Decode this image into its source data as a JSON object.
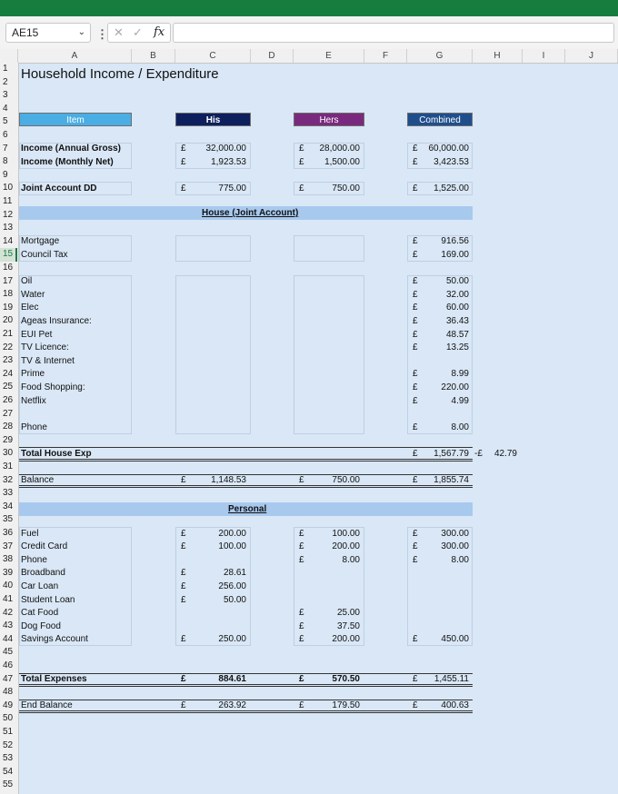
{
  "namebox": {
    "value": "AE15",
    "chevron": "⌄"
  },
  "formula": {
    "separator": "⋮",
    "cancel": "✕",
    "enter": "✓",
    "fx": "fx",
    "value": ""
  },
  "columns": [
    "A",
    "B",
    "C",
    "D",
    "E",
    "F",
    "G",
    "H",
    "I",
    "J"
  ],
  "title": "Household Income / Expenditure",
  "headers": {
    "item": "Item",
    "his": "His",
    "hers": "Hers",
    "combined": "Combined"
  },
  "income": [
    {
      "label": "Income (Annual Gross)",
      "his": "32,000.00",
      "hers": "28,000.00",
      "combined": "60,000.00"
    },
    {
      "label": "Income (Monthly Net)",
      "his": "1,923.53",
      "hers": "1,500.00",
      "combined": "3,423.53"
    }
  ],
  "joint_dd": {
    "label": "Joint Account DD",
    "his": "775.00",
    "hers": "750.00",
    "combined": "1,525.00"
  },
  "house_heading": "House (Joint Account)",
  "house_items": [
    {
      "row": 14,
      "label": "Mortgage",
      "combined": "916.56"
    },
    {
      "row": 15,
      "label": "Council Tax",
      "combined": "169.00"
    },
    {
      "row": 17,
      "label": "Oil",
      "combined": "50.00"
    },
    {
      "row": 18,
      "label": "Water",
      "combined": "32.00"
    },
    {
      "row": 19,
      "label": "Elec",
      "combined": "60.00"
    },
    {
      "row": 20,
      "label": "Ageas Insurance:",
      "combined": "36.43"
    },
    {
      "row": 21,
      "label": "EUI Pet",
      "combined": "48.57"
    },
    {
      "row": 22,
      "label": "TV Licence:",
      "combined": "13.25"
    },
    {
      "row": 23,
      "label": "TV & Internet",
      "combined": ""
    },
    {
      "row": 24,
      "label": "Prime",
      "combined": "8.99"
    },
    {
      "row": 25,
      "label": "Food Shopping:",
      "combined": "220.00"
    },
    {
      "row": 26,
      "label": "Netflix",
      "combined": "4.99"
    },
    {
      "row": 28,
      "label": "Phone",
      "combined": "8.00"
    }
  ],
  "total_house": {
    "label": "Total House Exp",
    "combined": "1,567.79",
    "diff": "42.79",
    "diff_prefix": "-£"
  },
  "balance": {
    "label": "Balance",
    "his": "1,148.53",
    "hers": "750.00",
    "combined": "1,855.74"
  },
  "personal_heading": "Personal",
  "personal_items": [
    {
      "row": 36,
      "label": "Fuel",
      "his": "200.00",
      "hers": "100.00",
      "combined": "300.00"
    },
    {
      "row": 37,
      "label": "Credit Card",
      "his": "100.00",
      "hers": "200.00",
      "combined": "300.00"
    },
    {
      "row": 38,
      "label": "Phone",
      "his": "",
      "hers": "8.00",
      "combined": "8.00"
    },
    {
      "row": 39,
      "label": "Broadband",
      "his": "28.61",
      "hers": "",
      "combined": ""
    },
    {
      "row": 40,
      "label": "Car Loan",
      "his": "256.00",
      "hers": "",
      "combined": ""
    },
    {
      "row": 41,
      "label": "Student Loan",
      "his": "50.00",
      "hers": "",
      "combined": ""
    },
    {
      "row": 42,
      "label": "Cat Food",
      "his": "",
      "hers": "25.00",
      "combined": ""
    },
    {
      "row": 43,
      "label": "Dog Food",
      "his": "",
      "hers": "37.50",
      "combined": ""
    },
    {
      "row": 44,
      "label": "Savings Account",
      "his": "250.00",
      "hers": "200.00",
      "combined": "450.00"
    }
  ],
  "total_expenses": {
    "label": "Total Expenses",
    "his": "884.61",
    "hers": "570.50",
    "combined": "1,455.11"
  },
  "end_balance": {
    "label": "End Balance",
    "his": "263.92",
    "hers": "179.50",
    "combined": "400.63"
  },
  "currency": "£",
  "selected_row": 15,
  "row_count": 55,
  "colors": {
    "item": "#4aaee4",
    "his": "#0d1f5c",
    "hers": "#7a2a7e",
    "combined": "#1f4e8c",
    "band": "#a8c9ee",
    "sheet": "#d9e7f6",
    "titlebar": "#167d3f"
  }
}
